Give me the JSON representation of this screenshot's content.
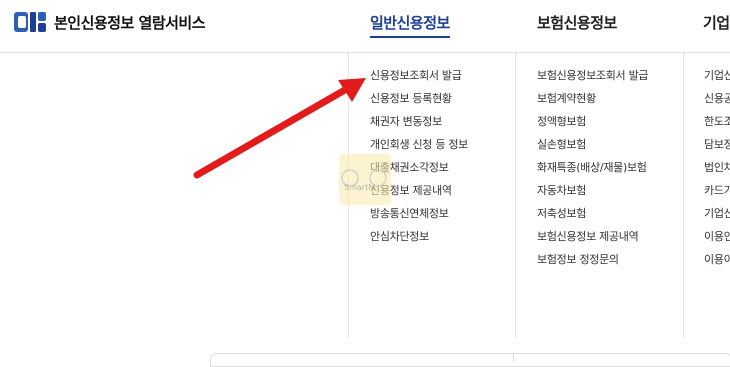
{
  "header": {
    "logo_icon": "cis-logo-icon",
    "service_title": "본인신용정보 열람서비스",
    "nav": [
      {
        "label": "일반신용정보",
        "active": true
      },
      {
        "label": "보험신용정보",
        "active": false
      },
      {
        "label": "기업",
        "active": false
      }
    ],
    "accent_color": "#1d3f97"
  },
  "menu": {
    "general": [
      "신용정보조회서 발급",
      "신용정보 등록현황",
      "채권자 변동정보",
      "개인회생 신청 등 정보",
      "대출채권소각정보",
      "신용정보 제공내역",
      "방송통신연체정보",
      "안심차단정보"
    ],
    "insurance": [
      "보험신용정보조회서 발급",
      "보험계약현황",
      "정액형보험",
      "실손형보험",
      "화재특종(배상/재물)보험",
      "자동차보험",
      "저축성보험",
      "보험신용정보 제공내역",
      "보험정보 정정문의"
    ],
    "corporate": [
      "기업신",
      "신용공",
      "한도조",
      "담보정",
      "법인차",
      "카드가",
      "기업신",
      "이용인",
      "이용이"
    ]
  },
  "overlay": {
    "arrow_color": "#e31b1b",
    "watermark_text": "SmartM"
  }
}
